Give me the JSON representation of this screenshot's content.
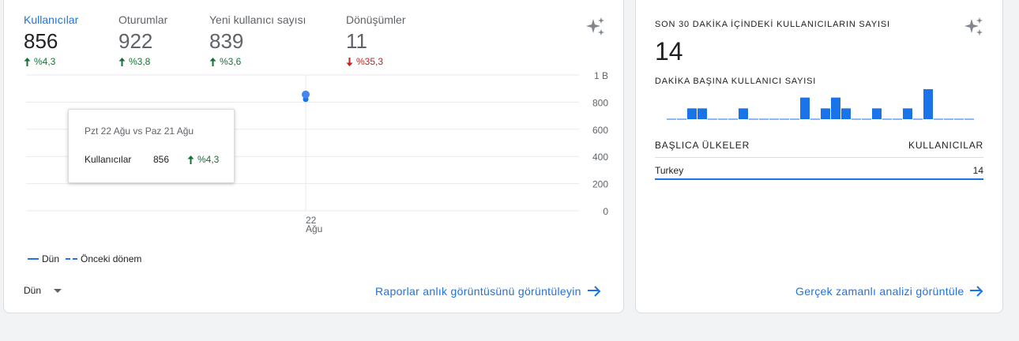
{
  "overview": {
    "metrics": [
      {
        "label": "Kullanıcılar",
        "value": "856",
        "delta": "%4,3",
        "direction": "up",
        "active": true
      },
      {
        "label": "Oturumlar",
        "value": "922",
        "delta": "%3,8",
        "direction": "up",
        "active": false
      },
      {
        "label": "Yeni kullanıcı sayısı",
        "value": "839",
        "delta": "%3,6",
        "direction": "up",
        "active": false
      },
      {
        "label": "Dönüşümler",
        "value": "11",
        "delta": "%35,3",
        "direction": "down",
        "active": false
      }
    ],
    "tooltip": {
      "title": "Pzt 22 Ağu vs Paz 21 Ağu",
      "metric": "Kullanıcılar",
      "value": "856",
      "delta": "%4,3"
    },
    "legend": {
      "current": "Dün",
      "previous": "Önceki dönem"
    },
    "period_select": "Dün",
    "link": "Raporlar anlık görüntüsünü görüntüleyin"
  },
  "chart_data": {
    "type": "line",
    "x": [
      "22 Ağu"
    ],
    "x_tick_lines": [
      "22",
      "Ağu"
    ],
    "series": [
      {
        "name": "Dün",
        "values": [
          856
        ]
      },
      {
        "name": "Önceki dönem",
        "values": [
          821
        ]
      }
    ],
    "y_ticks": [
      "0",
      "200",
      "400",
      "600",
      "800",
      "1 B"
    ],
    "y_tick_values": [
      0,
      200,
      400,
      600,
      800,
      1000
    ],
    "ylim": [
      0,
      1000
    ],
    "grid": true,
    "legend": "bottom-left"
  },
  "realtime": {
    "title": "SON 30 DAKİKA İÇİNDEKİ KULLANICILARIN SAYISI",
    "count": "14",
    "per_minute_title": "DAKİKA BAŞINA KULLANICI SAYISI",
    "per_minute_values": [
      0,
      0,
      1,
      1,
      0,
      0,
      0,
      1,
      0,
      0,
      0,
      0,
      0,
      2,
      0,
      1,
      2,
      1,
      0,
      0,
      1,
      0,
      0,
      1,
      0,
      3,
      0,
      0,
      0,
      0
    ],
    "table_headers": {
      "country": "BAŞLICA ÜLKELER",
      "users": "KULLANICILAR"
    },
    "rows": [
      {
        "country": "Turkey",
        "users": "14"
      }
    ],
    "link": "Gerçek zamanlı analizi görüntüle"
  },
  "colors": {
    "accent": "#1a73e8",
    "positive": "#137333",
    "negative": "#c5221f",
    "icon": "#80868b"
  }
}
